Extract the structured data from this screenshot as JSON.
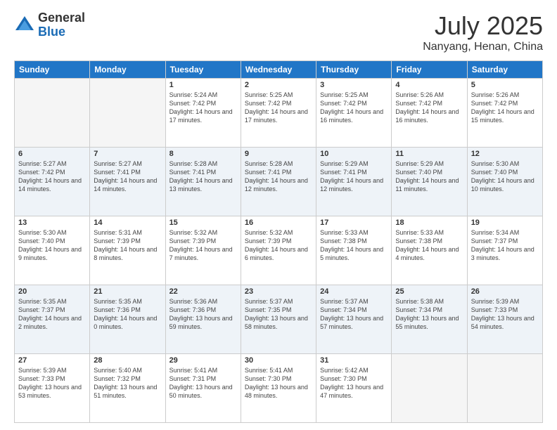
{
  "header": {
    "logo_general": "General",
    "logo_blue": "Blue",
    "month_title": "July 2025",
    "subtitle": "Nanyang, Henan, China"
  },
  "days_of_week": [
    "Sunday",
    "Monday",
    "Tuesday",
    "Wednesday",
    "Thursday",
    "Friday",
    "Saturday"
  ],
  "weeks": [
    {
      "row_class": "week-row-1",
      "days": [
        {
          "number": "",
          "info": "",
          "empty": true
        },
        {
          "number": "",
          "info": "",
          "empty": true
        },
        {
          "number": "1",
          "info": "Sunrise: 5:24 AM\nSunset: 7:42 PM\nDaylight: 14 hours and 17 minutes.",
          "empty": false
        },
        {
          "number": "2",
          "info": "Sunrise: 5:25 AM\nSunset: 7:42 PM\nDaylight: 14 hours and 17 minutes.",
          "empty": false
        },
        {
          "number": "3",
          "info": "Sunrise: 5:25 AM\nSunset: 7:42 PM\nDaylight: 14 hours and 16 minutes.",
          "empty": false
        },
        {
          "number": "4",
          "info": "Sunrise: 5:26 AM\nSunset: 7:42 PM\nDaylight: 14 hours and 16 minutes.",
          "empty": false
        },
        {
          "number": "5",
          "info": "Sunrise: 5:26 AM\nSunset: 7:42 PM\nDaylight: 14 hours and 15 minutes.",
          "empty": false
        }
      ]
    },
    {
      "row_class": "week-row-2",
      "days": [
        {
          "number": "6",
          "info": "Sunrise: 5:27 AM\nSunset: 7:42 PM\nDaylight: 14 hours and 14 minutes.",
          "empty": false
        },
        {
          "number": "7",
          "info": "Sunrise: 5:27 AM\nSunset: 7:41 PM\nDaylight: 14 hours and 14 minutes.",
          "empty": false
        },
        {
          "number": "8",
          "info": "Sunrise: 5:28 AM\nSunset: 7:41 PM\nDaylight: 14 hours and 13 minutes.",
          "empty": false
        },
        {
          "number": "9",
          "info": "Sunrise: 5:28 AM\nSunset: 7:41 PM\nDaylight: 14 hours and 12 minutes.",
          "empty": false
        },
        {
          "number": "10",
          "info": "Sunrise: 5:29 AM\nSunset: 7:41 PM\nDaylight: 14 hours and 12 minutes.",
          "empty": false
        },
        {
          "number": "11",
          "info": "Sunrise: 5:29 AM\nSunset: 7:40 PM\nDaylight: 14 hours and 11 minutes.",
          "empty": false
        },
        {
          "number": "12",
          "info": "Sunrise: 5:30 AM\nSunset: 7:40 PM\nDaylight: 14 hours and 10 minutes.",
          "empty": false
        }
      ]
    },
    {
      "row_class": "week-row-3",
      "days": [
        {
          "number": "13",
          "info": "Sunrise: 5:30 AM\nSunset: 7:40 PM\nDaylight: 14 hours and 9 minutes.",
          "empty": false
        },
        {
          "number": "14",
          "info": "Sunrise: 5:31 AM\nSunset: 7:39 PM\nDaylight: 14 hours and 8 minutes.",
          "empty": false
        },
        {
          "number": "15",
          "info": "Sunrise: 5:32 AM\nSunset: 7:39 PM\nDaylight: 14 hours and 7 minutes.",
          "empty": false
        },
        {
          "number": "16",
          "info": "Sunrise: 5:32 AM\nSunset: 7:39 PM\nDaylight: 14 hours and 6 minutes.",
          "empty": false
        },
        {
          "number": "17",
          "info": "Sunrise: 5:33 AM\nSunset: 7:38 PM\nDaylight: 14 hours and 5 minutes.",
          "empty": false
        },
        {
          "number": "18",
          "info": "Sunrise: 5:33 AM\nSunset: 7:38 PM\nDaylight: 14 hours and 4 minutes.",
          "empty": false
        },
        {
          "number": "19",
          "info": "Sunrise: 5:34 AM\nSunset: 7:37 PM\nDaylight: 14 hours and 3 minutes.",
          "empty": false
        }
      ]
    },
    {
      "row_class": "week-row-4",
      "days": [
        {
          "number": "20",
          "info": "Sunrise: 5:35 AM\nSunset: 7:37 PM\nDaylight: 14 hours and 2 minutes.",
          "empty": false
        },
        {
          "number": "21",
          "info": "Sunrise: 5:35 AM\nSunset: 7:36 PM\nDaylight: 14 hours and 0 minutes.",
          "empty": false
        },
        {
          "number": "22",
          "info": "Sunrise: 5:36 AM\nSunset: 7:36 PM\nDaylight: 13 hours and 59 minutes.",
          "empty": false
        },
        {
          "number": "23",
          "info": "Sunrise: 5:37 AM\nSunset: 7:35 PM\nDaylight: 13 hours and 58 minutes.",
          "empty": false
        },
        {
          "number": "24",
          "info": "Sunrise: 5:37 AM\nSunset: 7:34 PM\nDaylight: 13 hours and 57 minutes.",
          "empty": false
        },
        {
          "number": "25",
          "info": "Sunrise: 5:38 AM\nSunset: 7:34 PM\nDaylight: 13 hours and 55 minutes.",
          "empty": false
        },
        {
          "number": "26",
          "info": "Sunrise: 5:39 AM\nSunset: 7:33 PM\nDaylight: 13 hours and 54 minutes.",
          "empty": false
        }
      ]
    },
    {
      "row_class": "week-row-5",
      "days": [
        {
          "number": "27",
          "info": "Sunrise: 5:39 AM\nSunset: 7:33 PM\nDaylight: 13 hours and 53 minutes.",
          "empty": false
        },
        {
          "number": "28",
          "info": "Sunrise: 5:40 AM\nSunset: 7:32 PM\nDaylight: 13 hours and 51 minutes.",
          "empty": false
        },
        {
          "number": "29",
          "info": "Sunrise: 5:41 AM\nSunset: 7:31 PM\nDaylight: 13 hours and 50 minutes.",
          "empty": false
        },
        {
          "number": "30",
          "info": "Sunrise: 5:41 AM\nSunset: 7:30 PM\nDaylight: 13 hours and 48 minutes.",
          "empty": false
        },
        {
          "number": "31",
          "info": "Sunrise: 5:42 AM\nSunset: 7:30 PM\nDaylight: 13 hours and 47 minutes.",
          "empty": false
        },
        {
          "number": "",
          "info": "",
          "empty": true
        },
        {
          "number": "",
          "info": "",
          "empty": true
        }
      ]
    }
  ]
}
